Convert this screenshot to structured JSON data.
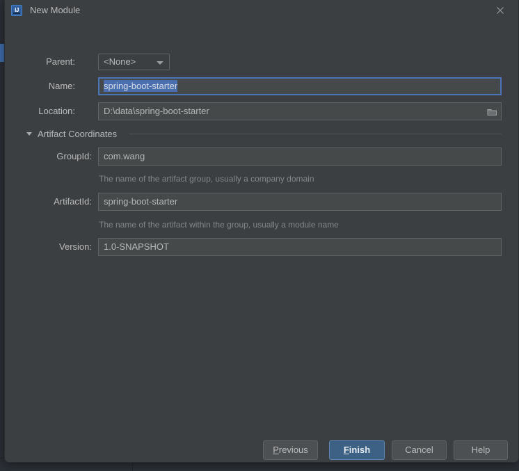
{
  "window": {
    "title": "New Module",
    "icon": "intellij-idea-icon",
    "close_icon": "close-icon"
  },
  "form": {
    "parent": {
      "label": "Parent:",
      "value": "<None>",
      "dropdown_icon": "chevron-down-icon"
    },
    "name": {
      "label": "Name:",
      "value": "spring-boot-starter",
      "selected": true
    },
    "location": {
      "label": "Location:",
      "value": "D:\\data\\spring-boot-starter",
      "browse_icon": "folder-icon"
    }
  },
  "artifact_section": {
    "title": "Artifact Coordinates",
    "expanded": true,
    "collapse_icon": "triangle-down-icon",
    "fields": [
      {
        "label": "GroupId:",
        "value": "com.wang",
        "hint": "The name of the artifact group, usually a company domain"
      },
      {
        "label": "ArtifactId:",
        "value": "spring-boot-starter",
        "hint": "The name of the artifact within the group, usually a module name"
      },
      {
        "label": "Version:",
        "value": "1.0-SNAPSHOT",
        "hint": ""
      }
    ]
  },
  "buttons": {
    "previous": {
      "label": "Previous",
      "mnemonic": "P"
    },
    "finish": {
      "label": "Finish",
      "mnemonic": "F",
      "primary": true
    },
    "cancel": {
      "label": "Cancel"
    },
    "help": {
      "label": "Help"
    }
  },
  "colors": {
    "dialog_bg": "#3c3f41",
    "field_bg": "#45494a",
    "accent": "#4a76b8",
    "selection": "#4b6eaf",
    "primary_button": "#3d6185",
    "text": "#bbbbbb",
    "hint_text": "#82868a"
  }
}
